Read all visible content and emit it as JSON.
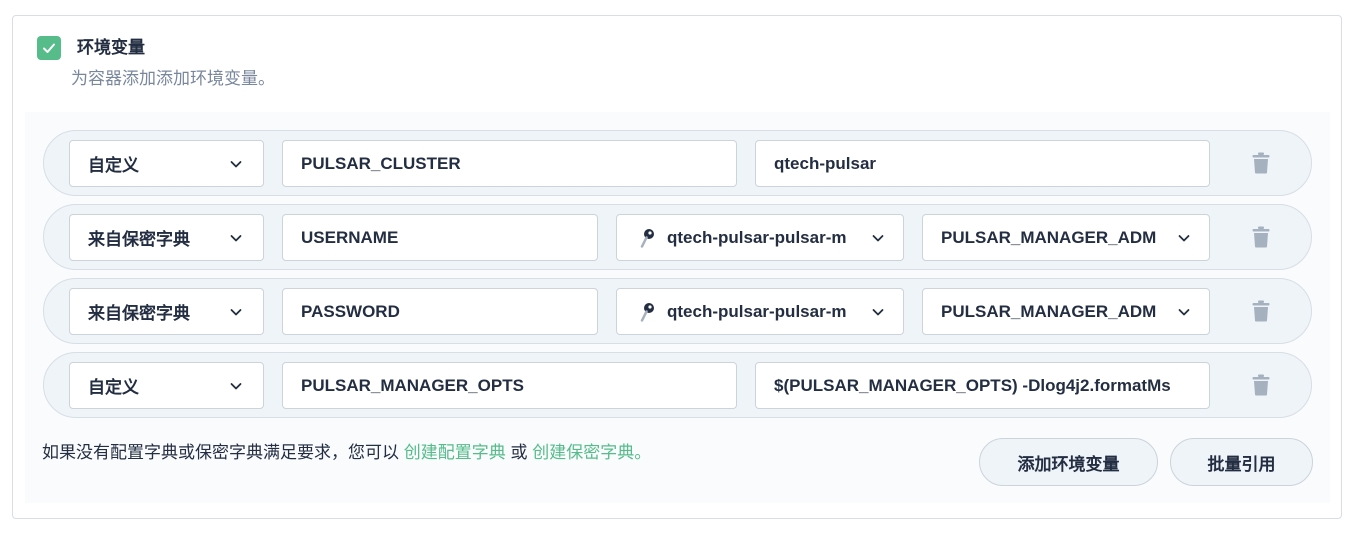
{
  "section": {
    "checked": true,
    "title": "环境变量",
    "description": "为容器添加添加环境变量。"
  },
  "rows": [
    {
      "type": "自定义",
      "name": "PULSAR_CLUSTER",
      "value": "qtech-pulsar"
    },
    {
      "type": "来自保密字典",
      "name": "USERNAME",
      "secret": "qtech-pulsar-pulsar-m",
      "key": "PULSAR_MANAGER_ADM"
    },
    {
      "type": "来自保密字典",
      "name": "PASSWORD",
      "secret": "qtech-pulsar-pulsar-m",
      "key": "PULSAR_MANAGER_ADM"
    },
    {
      "type": "自定义",
      "name": "PULSAR_MANAGER_OPTS",
      "value": "$(PULSAR_MANAGER_OPTS) -Dlog4j2.formatMs"
    }
  ],
  "footer": {
    "hint_prefix": "如果没有配置字典或保密字典满足要求，您可以",
    "link_configmap": "创建配置字典",
    "hint_or": "或",
    "link_secret": "创建保密字典",
    "hint_suffix": "。",
    "add_button": "添加环境变量",
    "batch_button": "批量引用"
  },
  "colors": {
    "accent": "#55bc8a",
    "text": "#242e42",
    "muted": "#79879c",
    "border": "#ccd3db",
    "row_bg": "#eff4f9"
  },
  "icons": {
    "checkbox": "check-icon",
    "dropdown": "chevron-down-icon",
    "secret": "key-icon",
    "delete": "trash-icon"
  }
}
